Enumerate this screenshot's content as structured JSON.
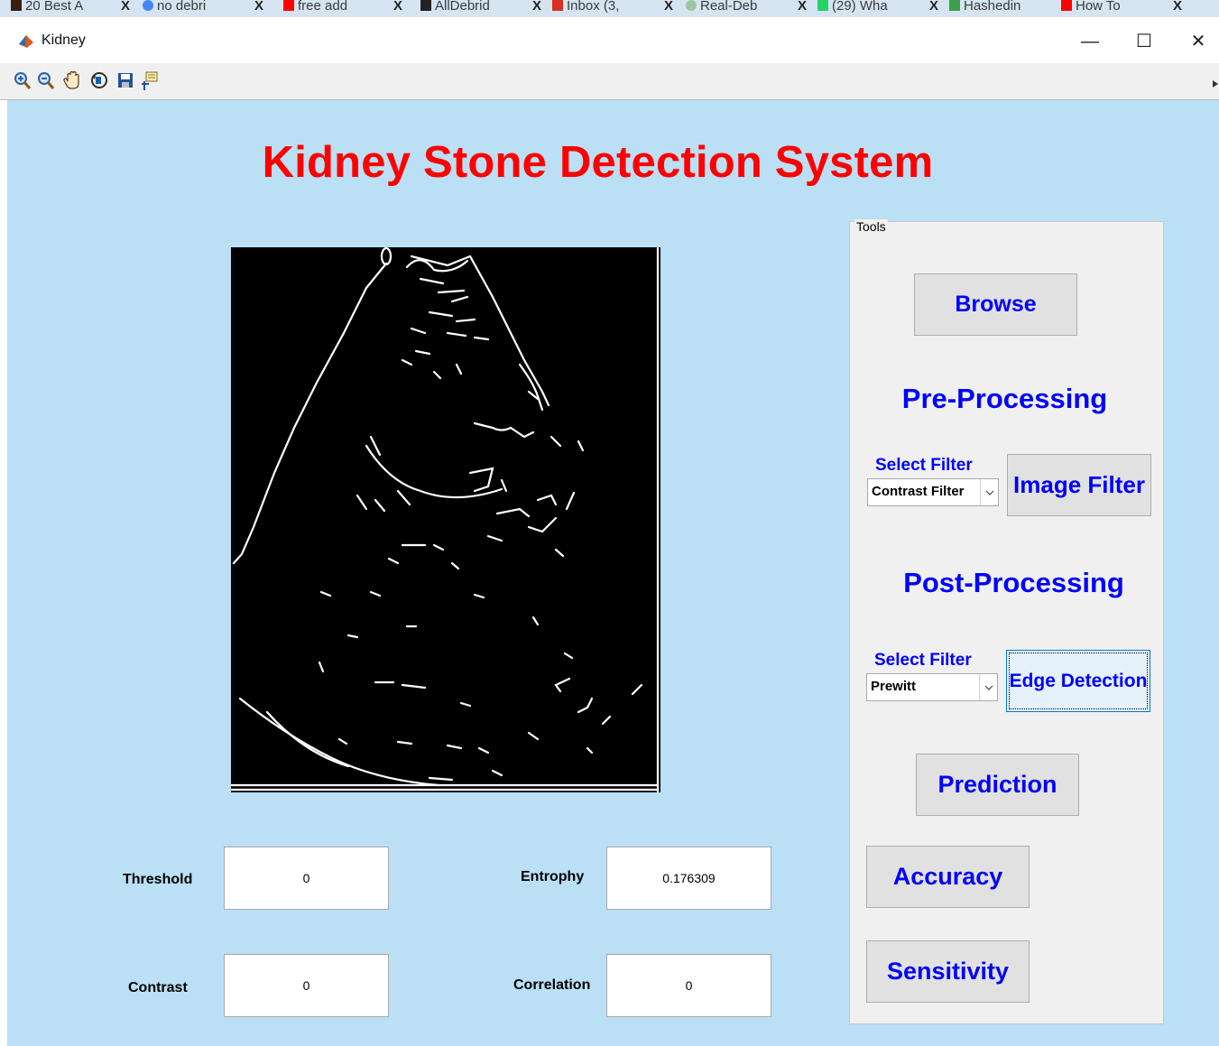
{
  "browser_tabs": [
    {
      "label": "20 Best A",
      "icon": "bookmark-icon"
    },
    {
      "label": "no debri",
      "icon": "google-icon"
    },
    {
      "label": "free add",
      "icon": "youtube-icon"
    },
    {
      "label": "AllDebrid",
      "icon": "alldebrid-icon"
    },
    {
      "label": "Inbox (3,",
      "icon": "gmail-icon"
    },
    {
      "label": "Real-Deb",
      "icon": "real-debrid-icon"
    },
    {
      "label": "(29) Wha",
      "icon": "whatsapp-icon"
    },
    {
      "label": "Hashedin",
      "icon": "hashedin-icon"
    },
    {
      "label": "How To",
      "icon": "youtube-icon"
    }
  ],
  "window": {
    "title": "Kidney",
    "minimize": "—",
    "maximize": "☐",
    "close": "✕"
  },
  "toolbar": {
    "tools": [
      "zoom-in-icon",
      "zoom-out-icon",
      "pan-hand-icon",
      "rotate-3d-icon",
      "save-icon",
      "data-cursor-icon"
    ]
  },
  "app": {
    "title": "Kidney Stone Detection System"
  },
  "metrics": {
    "threshold": {
      "label": "Threshold",
      "value": "0"
    },
    "entropy": {
      "label": "Entrophy",
      "value": "0.176309"
    },
    "contrast": {
      "label": "Contrast",
      "value": "0"
    },
    "correlation": {
      "label": "Correlation",
      "value": "0"
    }
  },
  "tools": {
    "legend": "Tools",
    "browse": "Browse",
    "pre_heading": "Pre-Processing",
    "pre_select_label": "Select Filter",
    "pre_select_value": "Contrast Filter",
    "image_filter": "Image Filter",
    "post_heading": "Post-Processing",
    "post_select_label": "Select Filter",
    "post_select_value": "Prewitt",
    "edge_detection": "Edge Detection",
    "prediction": "Prediction",
    "accuracy": "Accuracy",
    "sensitivity": "Sensitivity"
  },
  "colors": {
    "canvas": "#bbdff5",
    "title": "#ff0000",
    "button_text": "#0000ff",
    "panel": "#f0f0f0"
  }
}
